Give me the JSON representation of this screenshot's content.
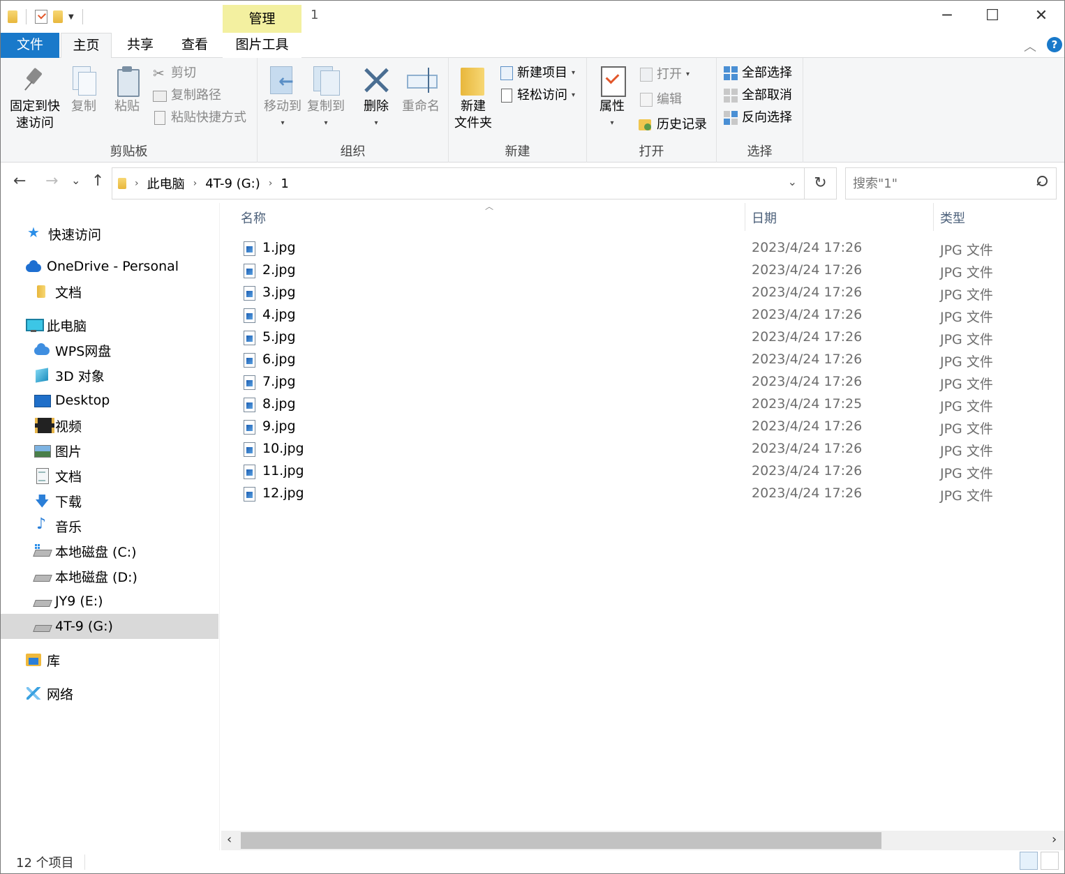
{
  "titlebar": {
    "manage_tab": "管理",
    "window_title": "1",
    "minimize_glyph": "─",
    "maximize_glyph": "☐",
    "close_glyph": "✕"
  },
  "ribbon_tabs": {
    "file": "文件",
    "home": "主页",
    "share": "共享",
    "view": "查看",
    "picture_tools": "图片工具",
    "collapse_glyph": "︿",
    "help_glyph": "?"
  },
  "ribbon": {
    "clipboard": {
      "label": "剪贴板",
      "pin_line1": "固定到快",
      "pin_line2": "速访问",
      "copy": "复制",
      "paste": "粘贴",
      "cut": "剪切",
      "copy_path": "复制路径",
      "paste_shortcut": "粘贴快捷方式"
    },
    "organize": {
      "label": "组织",
      "move_to": "移动到",
      "copy_to": "复制到",
      "delete": "删除",
      "rename": "重命名"
    },
    "new": {
      "label": "新建",
      "new_folder_line1": "新建",
      "new_folder_line2": "文件夹",
      "new_item": "新建项目",
      "easy_access": "轻松访问"
    },
    "open": {
      "label": "打开",
      "properties": "属性",
      "open": "打开",
      "edit": "编辑",
      "history": "历史记录"
    },
    "select": {
      "label": "选择",
      "select_all": "全部选择",
      "select_none": "全部取消",
      "invert": "反向选择"
    }
  },
  "nav": {
    "back_glyph": "←",
    "forward_glyph": "→",
    "recent_glyph": "⌄",
    "up_glyph": "↑",
    "refresh_glyph": "↻"
  },
  "address": {
    "crumbs": [
      "此电脑",
      "4T-9 (G:)",
      "1"
    ]
  },
  "search": {
    "placeholder": "搜索\"1\""
  },
  "sidebar": {
    "items": [
      {
        "label": "快速访问"
      },
      {
        "label": "OneDrive - Personal"
      },
      {
        "label": "文档"
      },
      {
        "label": "此电脑"
      },
      {
        "label": "WPS网盘"
      },
      {
        "label": "3D 对象"
      },
      {
        "label": "Desktop"
      },
      {
        "label": "视频"
      },
      {
        "label": "图片"
      },
      {
        "label": "文档"
      },
      {
        "label": "下载"
      },
      {
        "label": "音乐"
      },
      {
        "label": "本地磁盘 (C:)"
      },
      {
        "label": "本地磁盘 (D:)"
      },
      {
        "label": "JY9 (E:)"
      },
      {
        "label": "4T-9 (G:)"
      },
      {
        "label": "库"
      },
      {
        "label": "网络"
      }
    ]
  },
  "filelist": {
    "columns": {
      "name": "名称",
      "date": "日期",
      "type": "类型"
    },
    "rows": [
      {
        "name": "1.jpg",
        "date": "2023/4/24 17:26",
        "type": "JPG 文件"
      },
      {
        "name": "2.jpg",
        "date": "2023/4/24 17:26",
        "type": "JPG 文件"
      },
      {
        "name": "3.jpg",
        "date": "2023/4/24 17:26",
        "type": "JPG 文件"
      },
      {
        "name": "4.jpg",
        "date": "2023/4/24 17:26",
        "type": "JPG 文件"
      },
      {
        "name": "5.jpg",
        "date": "2023/4/24 17:26",
        "type": "JPG 文件"
      },
      {
        "name": "6.jpg",
        "date": "2023/4/24 17:26",
        "type": "JPG 文件"
      },
      {
        "name": "7.jpg",
        "date": "2023/4/24 17:26",
        "type": "JPG 文件"
      },
      {
        "name": "8.jpg",
        "date": "2023/4/24 17:25",
        "type": "JPG 文件"
      },
      {
        "name": "9.jpg",
        "date": "2023/4/24 17:26",
        "type": "JPG 文件"
      },
      {
        "name": "10.jpg",
        "date": "2023/4/24 17:26",
        "type": "JPG 文件"
      },
      {
        "name": "11.jpg",
        "date": "2023/4/24 17:26",
        "type": "JPG 文件"
      },
      {
        "name": "12.jpg",
        "date": "2023/4/24 17:26",
        "type": "JPG 文件"
      }
    ]
  },
  "statusbar": {
    "item_count": "12 个项目"
  },
  "colors": {
    "file_tab": "#1979ca",
    "manage_tab": "#f3f0a0",
    "selected_nav": "#d9d9d9",
    "ribbon_bg": "#f5f6f7"
  }
}
